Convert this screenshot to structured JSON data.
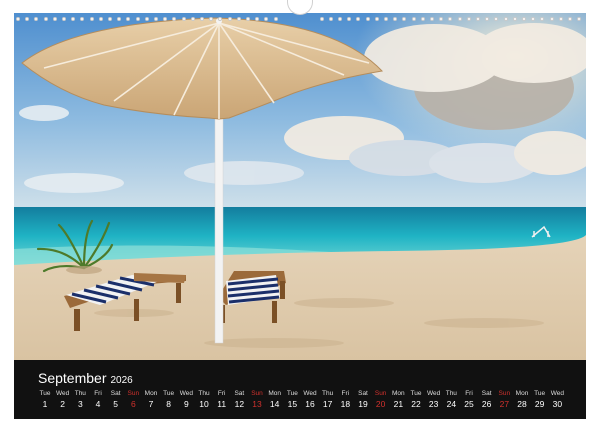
{
  "calendar": {
    "month": "September",
    "year": "2026",
    "days": [
      {
        "name": "Tue",
        "num": "1",
        "sunday": false
      },
      {
        "name": "Wed",
        "num": "2",
        "sunday": false
      },
      {
        "name": "Thu",
        "num": "3",
        "sunday": false
      },
      {
        "name": "Fri",
        "num": "4",
        "sunday": false
      },
      {
        "name": "Sat",
        "num": "5",
        "sunday": false
      },
      {
        "name": "Sun",
        "num": "6",
        "sunday": true
      },
      {
        "name": "Mon",
        "num": "7",
        "sunday": false
      },
      {
        "name": "Tue",
        "num": "8",
        "sunday": false
      },
      {
        "name": "Wed",
        "num": "9",
        "sunday": false
      },
      {
        "name": "Thu",
        "num": "10",
        "sunday": false
      },
      {
        "name": "Fri",
        "num": "11",
        "sunday": false
      },
      {
        "name": "Sat",
        "num": "12",
        "sunday": false
      },
      {
        "name": "Sun",
        "num": "13",
        "sunday": true
      },
      {
        "name": "Mon",
        "num": "14",
        "sunday": false
      },
      {
        "name": "Tue",
        "num": "15",
        "sunday": false
      },
      {
        "name": "Wed",
        "num": "16",
        "sunday": false
      },
      {
        "name": "Thu",
        "num": "17",
        "sunday": false
      },
      {
        "name": "Fri",
        "num": "18",
        "sunday": false
      },
      {
        "name": "Sat",
        "num": "19",
        "sunday": false
      },
      {
        "name": "Sun",
        "num": "20",
        "sunday": true
      },
      {
        "name": "Mon",
        "num": "21",
        "sunday": false
      },
      {
        "name": "Tue",
        "num": "22",
        "sunday": false
      },
      {
        "name": "Wed",
        "num": "23",
        "sunday": false
      },
      {
        "name": "Thu",
        "num": "24",
        "sunday": false
      },
      {
        "name": "Fri",
        "num": "25",
        "sunday": false
      },
      {
        "name": "Sat",
        "num": "26",
        "sunday": false
      },
      {
        "name": "Sun",
        "num": "27",
        "sunday": true
      },
      {
        "name": "Mon",
        "num": "28",
        "sunday": false
      },
      {
        "name": "Tue",
        "num": "29",
        "sunday": false
      },
      {
        "name": "Wed",
        "num": "30",
        "sunday": false
      }
    ]
  },
  "colors": {
    "calendar_bar": "#111111",
    "sunday": "#d0312d",
    "sky": "#6aa6d8",
    "sea": "#1fb3c4",
    "sand": "#e8d6bc",
    "umbrella": "#d9b98e"
  }
}
